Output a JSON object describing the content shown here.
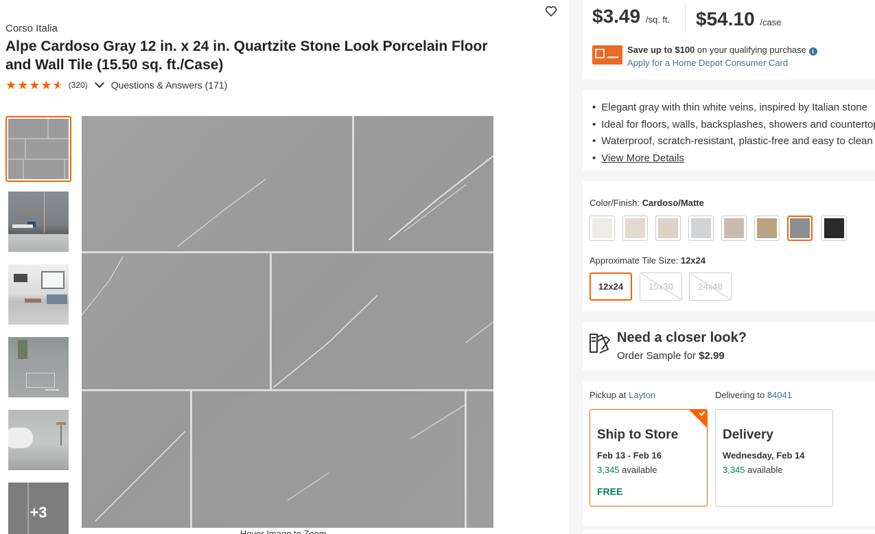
{
  "product": {
    "brand": "Corso Italia",
    "title": "Alpe Cardoso Gray 12 in. x 24 in. Quartzite Stone Look Porcelain Floor and Wall Tile (15.50 sq. ft./Case)",
    "rating": 4.5,
    "review_count": "(320)",
    "questions_answers": "Questions & Answers (171)",
    "more_images": "+3",
    "image_caption": "Hover Image to Zoom"
  },
  "price": {
    "per_unit": "$3.49",
    "per_unit_label": "/sq. ft.",
    "per_case": "$54.10",
    "per_case_label": "/case"
  },
  "credit_offer": {
    "prefix": "Save up to ",
    "amount": "$100",
    "suffix": " on your qualifying purchase",
    "link": "Apply for a Home Depot Consumer Card"
  },
  "highlights": [
    "Elegant gray with thin white veins, inspired by Italian stone",
    "Ideal for floors, walls, backsplashes, showers and countertops",
    "Waterproof, scratch-resistant, plastic-free and easy to clean"
  ],
  "view_more_details": "View More Details",
  "color_finish": {
    "label": "Color/Finish: ",
    "value": "Cardoso/Matte",
    "swatches": [
      {
        "name": "white",
        "color": "#eeece7"
      },
      {
        "name": "cream",
        "color": "#e4d9cf"
      },
      {
        "name": "beige",
        "color": "#ddd2c7"
      },
      {
        "name": "light-gray",
        "color": "#d2d3d4"
      },
      {
        "name": "taupe",
        "color": "#c9bbb1"
      },
      {
        "name": "tan",
        "color": "#b8a382"
      },
      {
        "name": "gray",
        "color": "#8c8e8d",
        "selected": true
      },
      {
        "name": "black",
        "color": "#2a2a2b"
      }
    ]
  },
  "tile_size": {
    "label": "Approximate Tile Size: ",
    "value": "12x24",
    "options": [
      "12x24",
      "15x30",
      "24x48"
    ]
  },
  "sample": {
    "title": "Need a closer look?",
    "prefix": "Order Sample for ",
    "price": "$2.99"
  },
  "fulfillment": {
    "pickup_label": "Pickup at ",
    "pickup_store": "Layton",
    "deliver_label": "Delivering to ",
    "deliver_zip": "84041",
    "ship_to_store": {
      "title": "Ship to Store",
      "date": "Feb 13 - Feb 16",
      "count": "3,345",
      "avail": " available",
      "cost": "FREE"
    },
    "delivery": {
      "title": "Delivery",
      "date": "Wednesday, Feb 14",
      "count": "3,345",
      "avail": " available"
    }
  },
  "colors": {
    "accent": "#f96302",
    "link": "#3e7697",
    "green": "#00805d"
  }
}
